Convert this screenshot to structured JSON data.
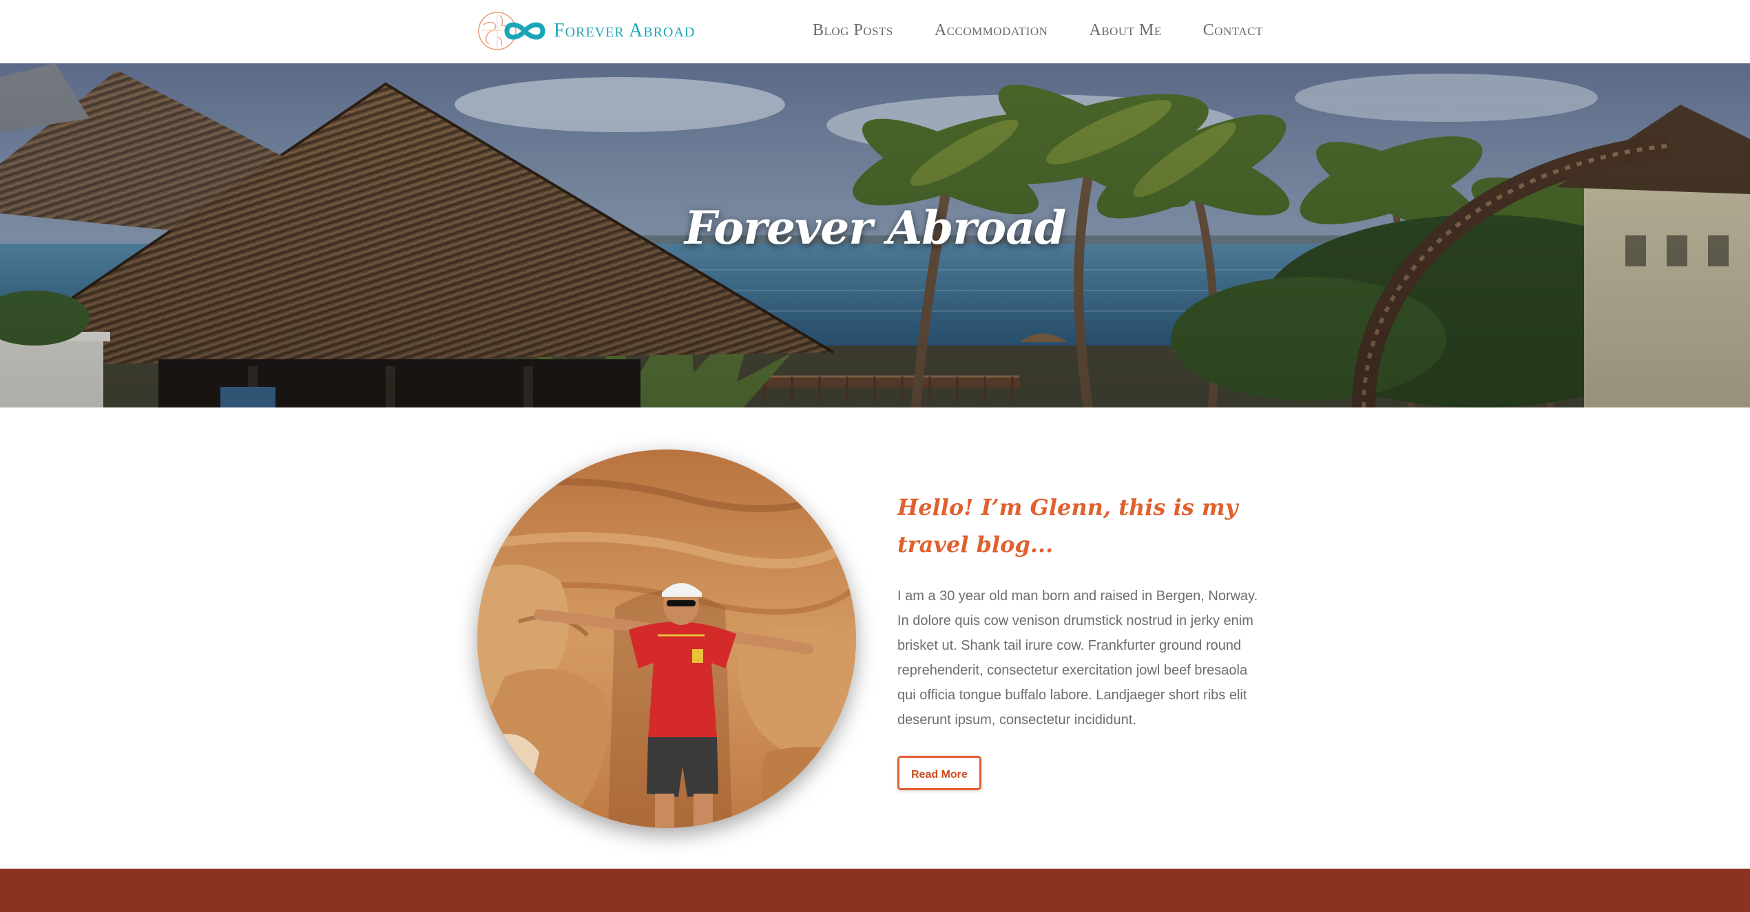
{
  "brand": {
    "name": "Forever Abroad",
    "logo_icon": "globe-infinity-logo-icon",
    "color": "#1aa5b8"
  },
  "nav": {
    "items": [
      {
        "label": "Blog Posts"
      },
      {
        "label": "Accommodation"
      },
      {
        "label": "About Me"
      },
      {
        "label": "Contact"
      }
    ]
  },
  "hero": {
    "title": "Forever Abroad",
    "image": "tropical-resort-beach-photo"
  },
  "intro": {
    "heading": "Hello! I’m Glenn, this is my travel blog...",
    "body": "I am a 30 year old man born and raised in Bergen, Norway. In dolore quis cow venison drumstick nostrud in jerky enim brisket ut. Shank tail irure cow. Frankfurter ground round reprehenderit, consectetur exercitation jowl beef bresaola qui officia tongue buffalo labore. Landjaeger short ribs elit deserunt ipsum, consectetur incididunt.",
    "button_label": "Read More",
    "portrait_image": "man-in-red-shirt-at-rock-canyon-photo",
    "accent_color": "#e0602e"
  },
  "footer": {
    "color": "#8b3320"
  }
}
